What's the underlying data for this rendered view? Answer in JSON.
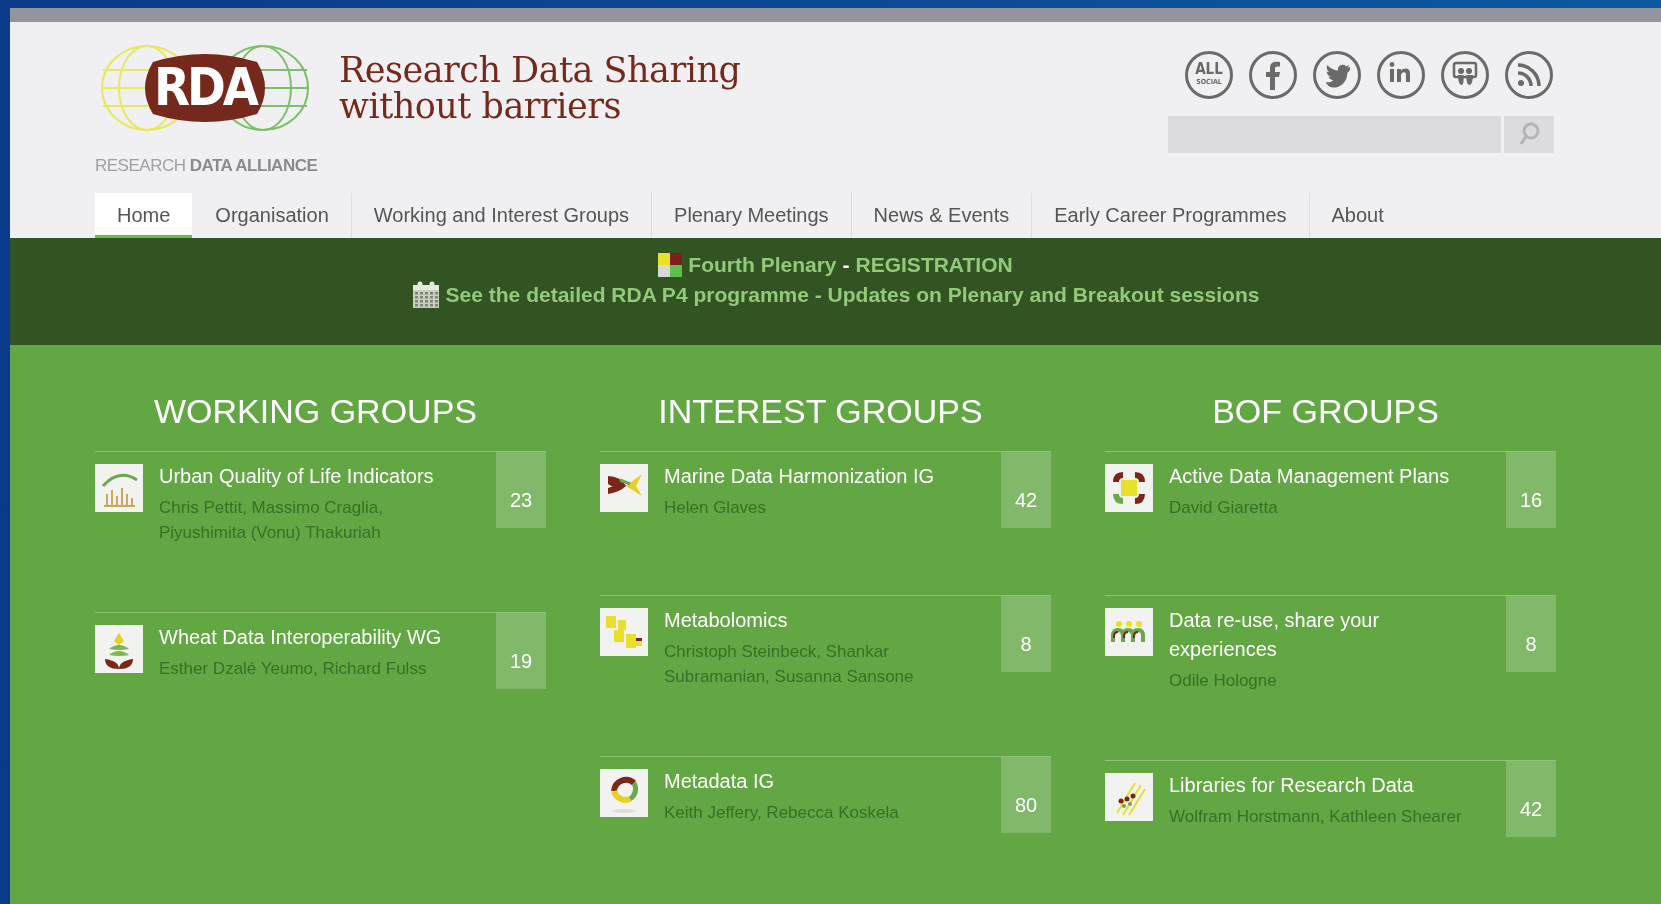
{
  "header": {
    "logo": {
      "mark": "RDA",
      "name": "RESEARCH **DATA ALLIANCE**"
    },
    "tagline": [
      "Research Data Sharing",
      "without barriers"
    ],
    "social": [
      {
        "kind": "all-social",
        "label": "ALL",
        "sublabel": "SOCIAL"
      },
      {
        "kind": "facebook"
      },
      {
        "kind": "twitter"
      },
      {
        "kind": "linkedin"
      },
      {
        "kind": "slideshare"
      },
      {
        "kind": "rss"
      }
    ]
  },
  "nav": [
    {
      "label": "Home",
      "selected": true
    },
    {
      "label": "Organisation",
      "selected": false
    },
    {
      "label": "Working and Interest Groups",
      "selected": false
    },
    {
      "label": "Plenary Meetings",
      "selected": false
    },
    {
      "label": "News & Events",
      "selected": false
    },
    {
      "label": "Early Career Programmes",
      "selected": false
    },
    {
      "label": "About",
      "selected": false
    }
  ],
  "banner": {
    "line_1": {
      "link": "Fourth Plenary",
      "separator": "-",
      "link_2": "REGISTRATION"
    },
    "line_2": {
      "link": "See the detailed RDA P4 programme - Updates on Plenary and Breakout sessions"
    }
  },
  "columns": [
    {
      "title": "WORKING GROUPS",
      "groups": [
        {
          "name": "Urban Quality of Life Indicators",
          "people": "Chris Pettit, Massimo Craglia, Piyushimita (Vonu) Thakuriah",
          "count": "23"
        },
        {
          "name": "Wheat Data Interoperability WG",
          "people": "Esther Dzalé Yeumo, Richard Fulss",
          "count": "19"
        }
      ]
    },
    {
      "title": "INTEREST GROUPS",
      "groups": [
        {
          "name": "Marine Data Harmonization IG",
          "people": "Helen Glaves",
          "count": "42"
        },
        {
          "name": "Metabolomics",
          "people": "Christoph Steinbeck, Shankar Subramanian, Susanna Sansone",
          "count": "8"
        },
        {
          "name": "Metadata IG",
          "people": "Keith Jeffery, Rebecca Koskela",
          "count": "80"
        }
      ]
    },
    {
      "title": "BOF GROUPS",
      "groups": [
        {
          "name": "Active Data Management Plans",
          "people": "David Giaretta",
          "count": "16"
        },
        {
          "name": "Data re-use, share your experiences",
          "people": "Odile Hologne",
          "count": "8"
        },
        {
          "name": "Libraries for Research Data",
          "people": "Wolfram Horstmann, Kathleen Shearer",
          "count": "42"
        }
      ]
    }
  ]
}
